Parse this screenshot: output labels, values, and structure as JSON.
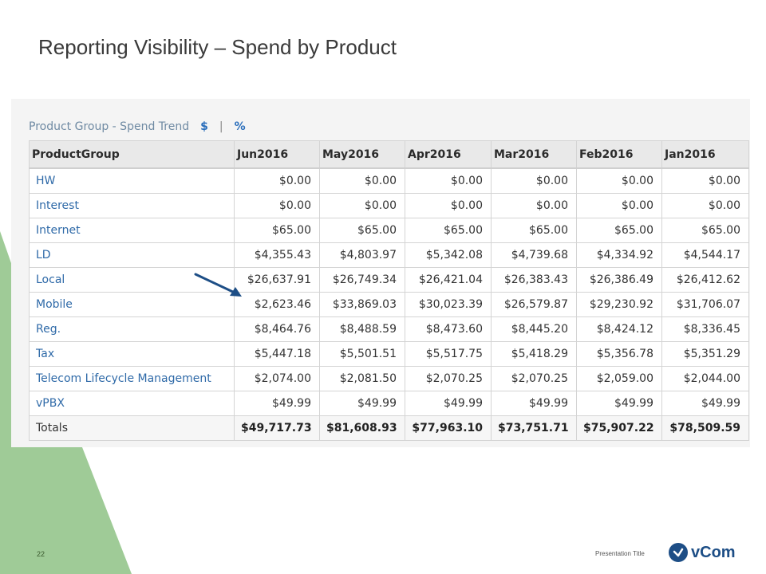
{
  "slide": {
    "title": "Reporting Visibility – Spend by Product",
    "page_number": "22",
    "footer_title": "Presentation Title",
    "logo_text": "vCom",
    "brand_color": "#1d4e86",
    "accent_green": "#9fcb97"
  },
  "report": {
    "title": "Product Group - Spend Trend",
    "toggle_dollar": "$",
    "separator": "|",
    "toggle_percent": "%",
    "columns": [
      "ProductGroup",
      "Jun2016",
      "May2016",
      "Apr2016",
      "Mar2016",
      "Feb2016",
      "Jan2016"
    ],
    "rows": [
      [
        "HW",
        "$0.00",
        "$0.00",
        "$0.00",
        "$0.00",
        "$0.00",
        "$0.00"
      ],
      [
        "Interest",
        "$0.00",
        "$0.00",
        "$0.00",
        "$0.00",
        "$0.00",
        "$0.00"
      ],
      [
        "Internet",
        "$65.00",
        "$65.00",
        "$65.00",
        "$65.00",
        "$65.00",
        "$65.00"
      ],
      [
        "LD",
        "$4,355.43",
        "$4,803.97",
        "$5,342.08",
        "$4,739.68",
        "$4,334.92",
        "$4,544.17"
      ],
      [
        "Local",
        "$26,637.91",
        "$26,749.34",
        "$26,421.04",
        "$26,383.43",
        "$26,386.49",
        "$26,412.62"
      ],
      [
        "Mobile",
        "$2,623.46",
        "$33,869.03",
        "$30,023.39",
        "$26,579.87",
        "$29,230.92",
        "$31,706.07"
      ],
      [
        "Reg.",
        "$8,464.76",
        "$8,488.59",
        "$8,473.60",
        "$8,445.20",
        "$8,424.12",
        "$8,336.45"
      ],
      [
        "Tax",
        "$5,447.18",
        "$5,501.51",
        "$5,517.75",
        "$5,418.29",
        "$5,356.78",
        "$5,351.29"
      ],
      [
        "Telecom Lifecycle Management",
        "$2,074.00",
        "$2,081.50",
        "$2,070.25",
        "$2,070.25",
        "$2,059.00",
        "$2,044.00"
      ],
      [
        "vPBX",
        "$49.99",
        "$49.99",
        "$49.99",
        "$49.99",
        "$49.99",
        "$49.99"
      ]
    ],
    "totals": [
      "Totals",
      "$49,717.73",
      "$81,608.93",
      "$77,963.10",
      "$73,751.71",
      "$75,907.22",
      "$78,509.59"
    ]
  }
}
